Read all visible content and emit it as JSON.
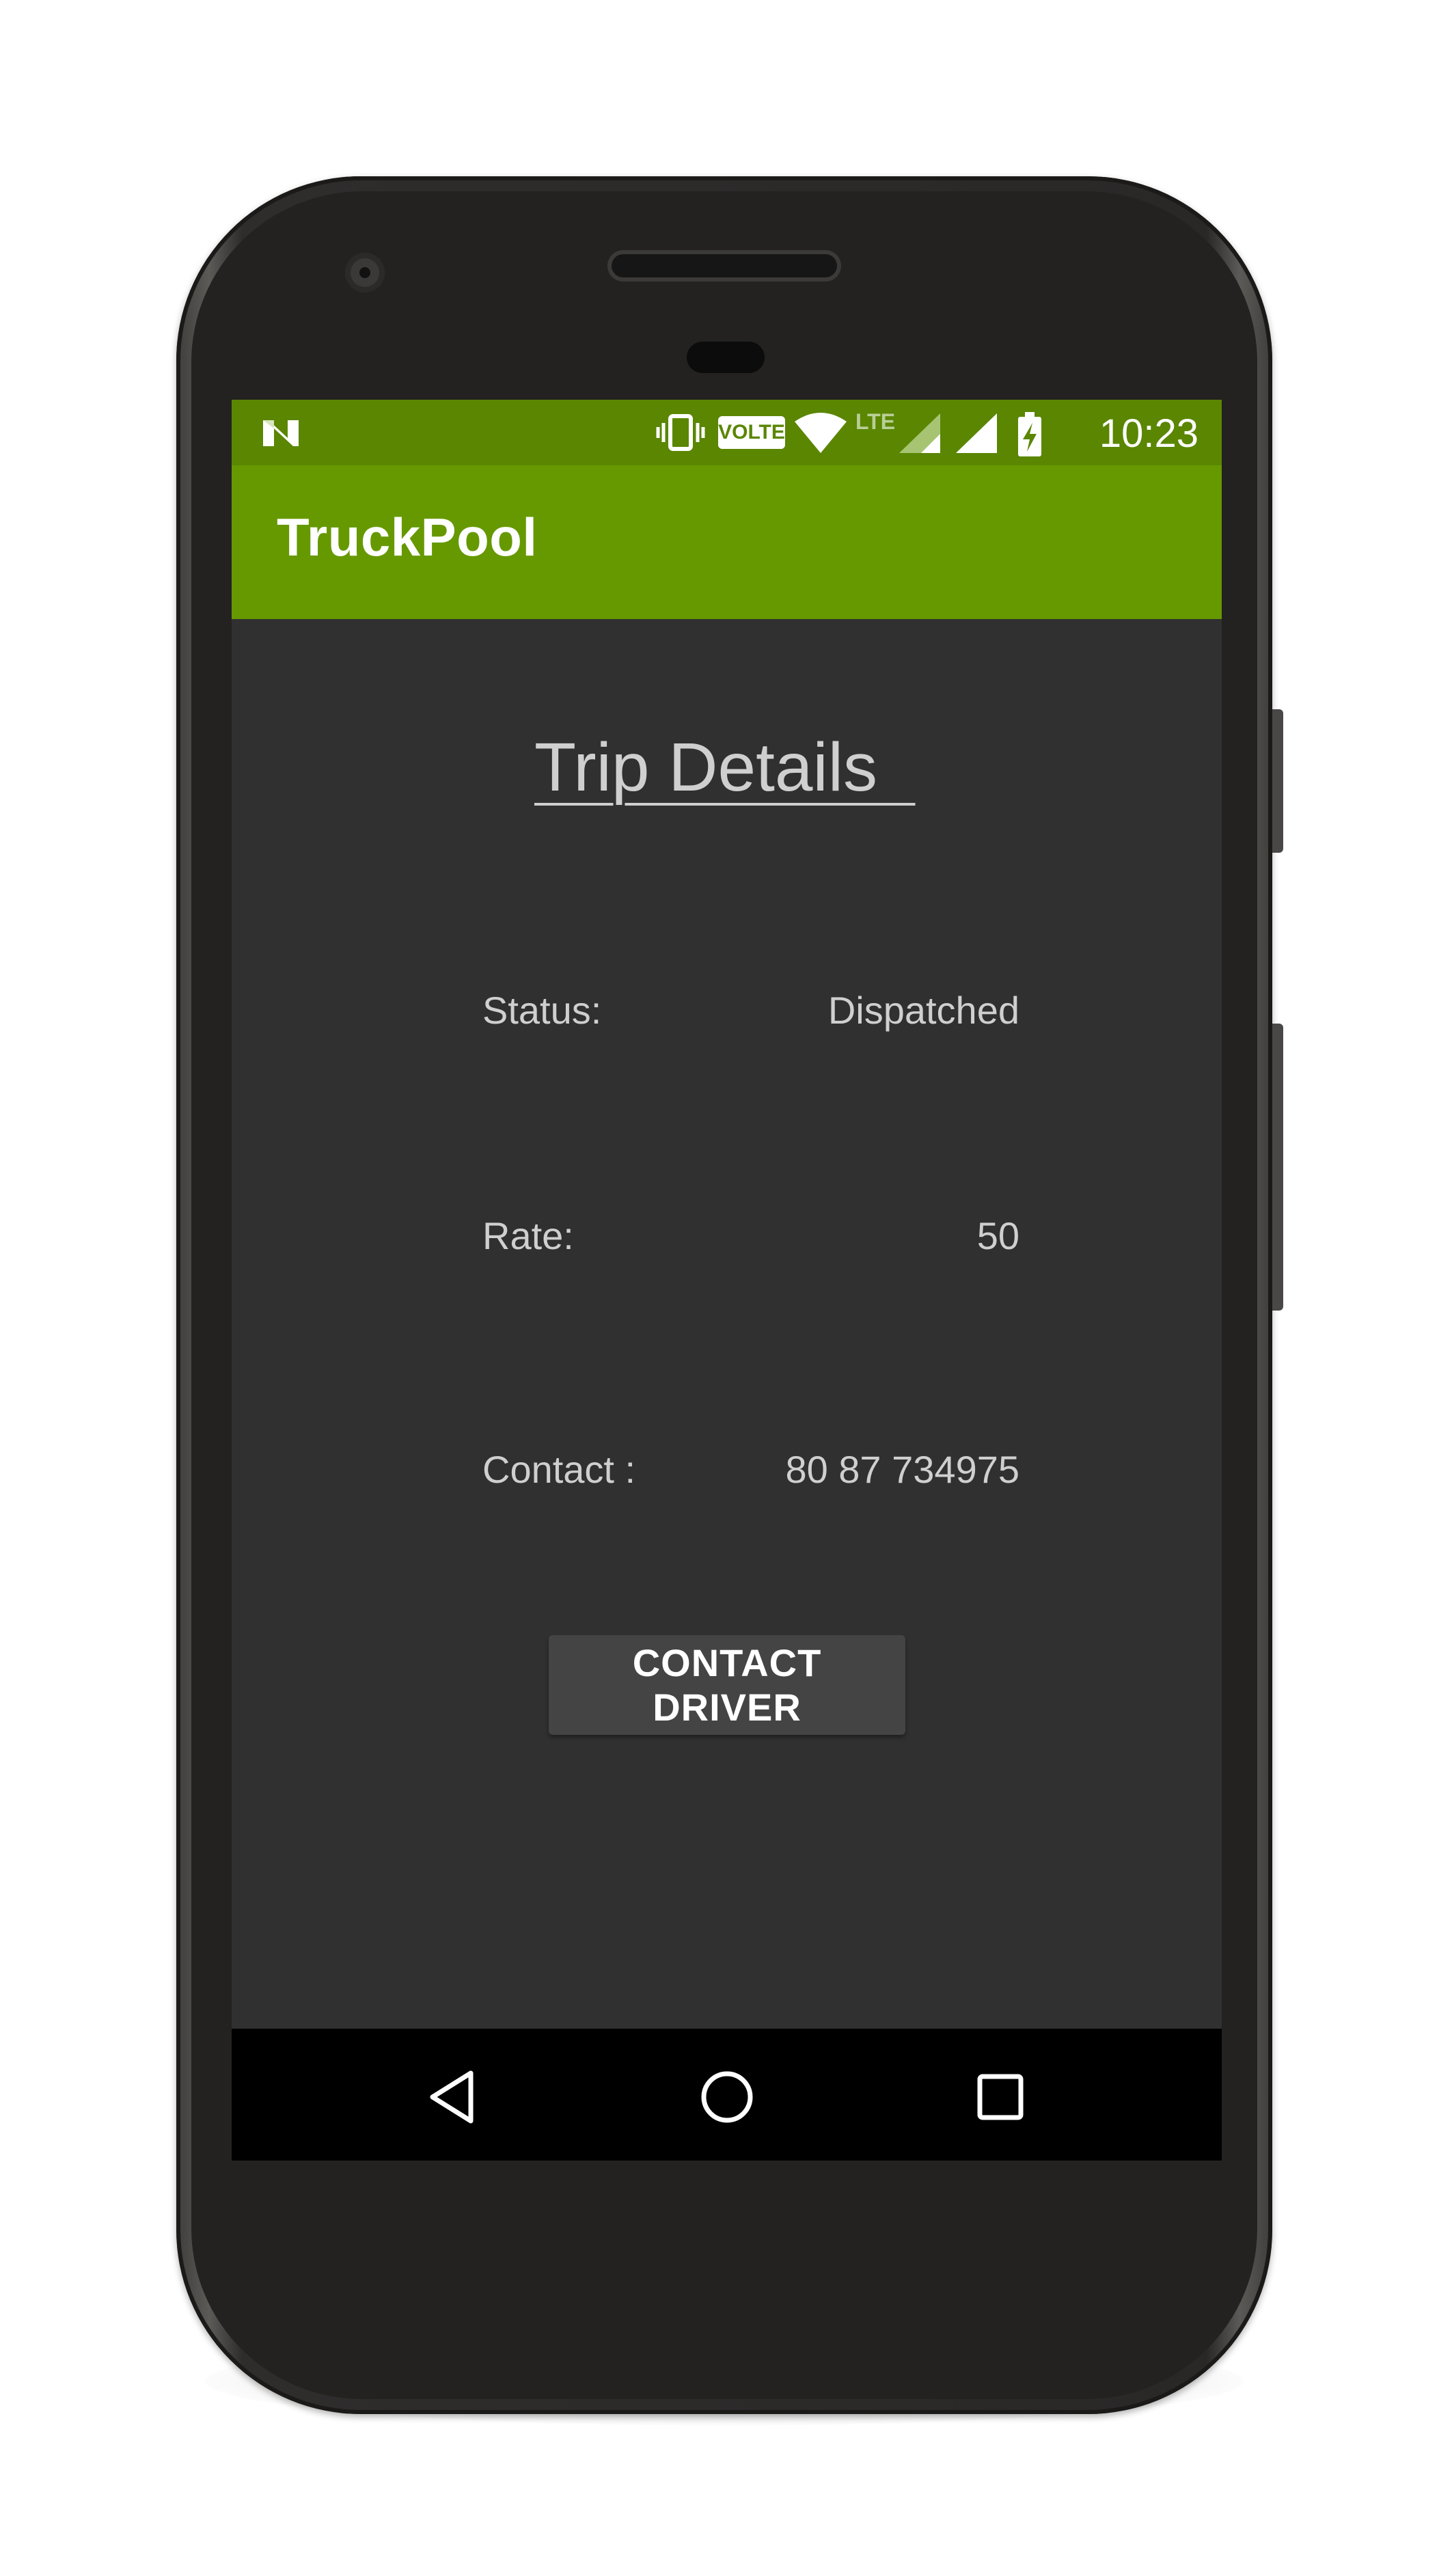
{
  "status_bar": {
    "time": "10:23",
    "volte_label": "VOLTE",
    "lte_label": "LTE",
    "icons": [
      "notification-n-icon",
      "vibrate-icon",
      "volte-icon",
      "wifi-icon",
      "lte-signal-icon",
      "signal-icon",
      "battery-charging-icon"
    ]
  },
  "app_bar": {
    "title": "TruckPool"
  },
  "trip": {
    "title": "Trip Details  ",
    "status_label": "Status:",
    "status_value": "Dispatched",
    "rate_label": "Rate:",
    "rate_value": "50",
    "contact_label": "Contact :",
    "contact_value": "80 87 734975"
  },
  "actions": {
    "contact_driver": "CONTACT DRIVER"
  },
  "nav_bar": {
    "icons": [
      "back-icon",
      "home-icon",
      "recents-icon"
    ]
  },
  "colors": {
    "status_bar": "#5a8602",
    "app_bar": "#669900",
    "background": "#303030",
    "text": "#cfcfcf",
    "button": "#444444"
  }
}
